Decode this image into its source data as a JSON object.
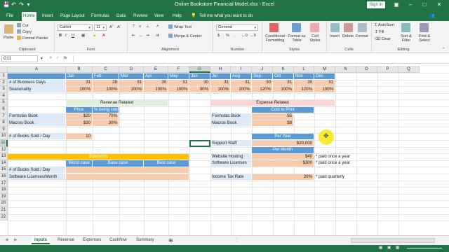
{
  "window": {
    "title": "Online Bookstore Financial Model.xlsx  -  Excel",
    "sign_in": "Sign in"
  },
  "ribbon_tabs": [
    "File",
    "Home",
    "Insert",
    "Page Layout",
    "Formulas",
    "Data",
    "Review",
    "View",
    "Help"
  ],
  "tell_me": "Tell me what you want to do",
  "clipboard": {
    "paste": "Paste",
    "cut": "Cut",
    "copy": "Copy",
    "format_painter": "Format Painter",
    "label": "Clipboard"
  },
  "font": {
    "name": "Calibri",
    "size": "11",
    "label": "Font",
    "bold": "B",
    "italic": "I",
    "underline": "U"
  },
  "alignment": {
    "wrap": "Wrap Text",
    "merge": "Merge & Center",
    "label": "Alignment"
  },
  "number": {
    "format": "General",
    "label": "Number",
    "currency": "$",
    "percent": "%"
  },
  "styles": {
    "conditional": "Conditional Formatting",
    "format_table": "Format as Table",
    "cell_styles": "Cell Styles",
    "label": "Styles"
  },
  "cells": {
    "insert": "Insert",
    "delete": "Delete",
    "format": "Format",
    "label": "Cells"
  },
  "editing": {
    "autosum": "AutoSum",
    "fill": "Fill",
    "clear": "Clear",
    "sort": "Sort & Filter",
    "find": "Find & Select",
    "label": "Editing"
  },
  "formula_bar": {
    "name_box": "G11",
    "fx": "fx",
    "value": ""
  },
  "columns": [
    "A",
    "B",
    "C",
    "D",
    "E",
    "F",
    "G",
    "H",
    "I",
    "J",
    "K",
    "L",
    "M",
    "N",
    "O",
    "P",
    "Q"
  ],
  "rows": [
    "1",
    "2",
    "3",
    "4",
    "5",
    "6",
    "7",
    "8",
    "9",
    "10",
    "11",
    "12",
    "13",
    "14",
    "15",
    "16",
    "17",
    "18",
    "19",
    "20",
    "21",
    "22"
  ],
  "sheet": {
    "months": [
      "Jan",
      "Feb",
      "Mar",
      "Apr",
      "May",
      "Jun",
      "Jul",
      "Aug",
      "Sep",
      "Oct",
      "Nov",
      "Dec"
    ],
    "business_days_label": "# of Business Days",
    "business_days": [
      "31",
      "28",
      "31",
      "30",
      "31",
      "30",
      "31",
      "31",
      "30",
      "31",
      "30",
      "31"
    ],
    "seasonality_label": "Seasonality",
    "seasonality": [
      "100%",
      "100%",
      "100%",
      "100%",
      "100%",
      "90%",
      "100%",
      "100%",
      "120%",
      "100%",
      "120%",
      "100%"
    ],
    "revenue_related": "Revenue Related",
    "price_hdr": "Price",
    "pct_sold_hdr": "% being sold",
    "formulas_book": "Formulas Book",
    "macros_book": "Macros Book",
    "formulas_price": "$20",
    "formulas_pct": "70%",
    "macros_price": "$30",
    "macros_pct": "30%",
    "books_sold_label": "# of Books Sold / Day",
    "books_sold": "10",
    "expense_related": "Expense Related",
    "cost_to_print": "Cost to Print",
    "formulas_cost": "$5",
    "macros_cost": "$8",
    "per_year": "Per Year",
    "support_staff": "Support Staff",
    "support_staff_cost": "$20,000",
    "per_month": "Per Month",
    "website_hosting": "Website Hosting",
    "website_hosting_cost": "$40",
    "website_note": "* paid once a year",
    "software_licenses": "Software Licenses",
    "software_cost": "$300",
    "software_note": "* paid once a year",
    "income_tax": "Income Tax Rate",
    "income_tax_rate": "20%",
    "tax_note": "* paid quarterly",
    "scenarios": "Scenarios",
    "worst_case": "Worst case",
    "base_case": "Base case",
    "best_case": "Best case",
    "books_sold_day": "# of Books Sold / Day",
    "software_per_month": "Software Licenses/Month"
  },
  "sheet_tabs": [
    "Inputs",
    "Revenue",
    "Expenses",
    "Cashflow",
    "Summary"
  ],
  "colors": {
    "excel_green": "#217346",
    "header_blue": "#5b9bd5",
    "input_orange": "#f8cbad",
    "scenario_gold": "#ffc000"
  }
}
